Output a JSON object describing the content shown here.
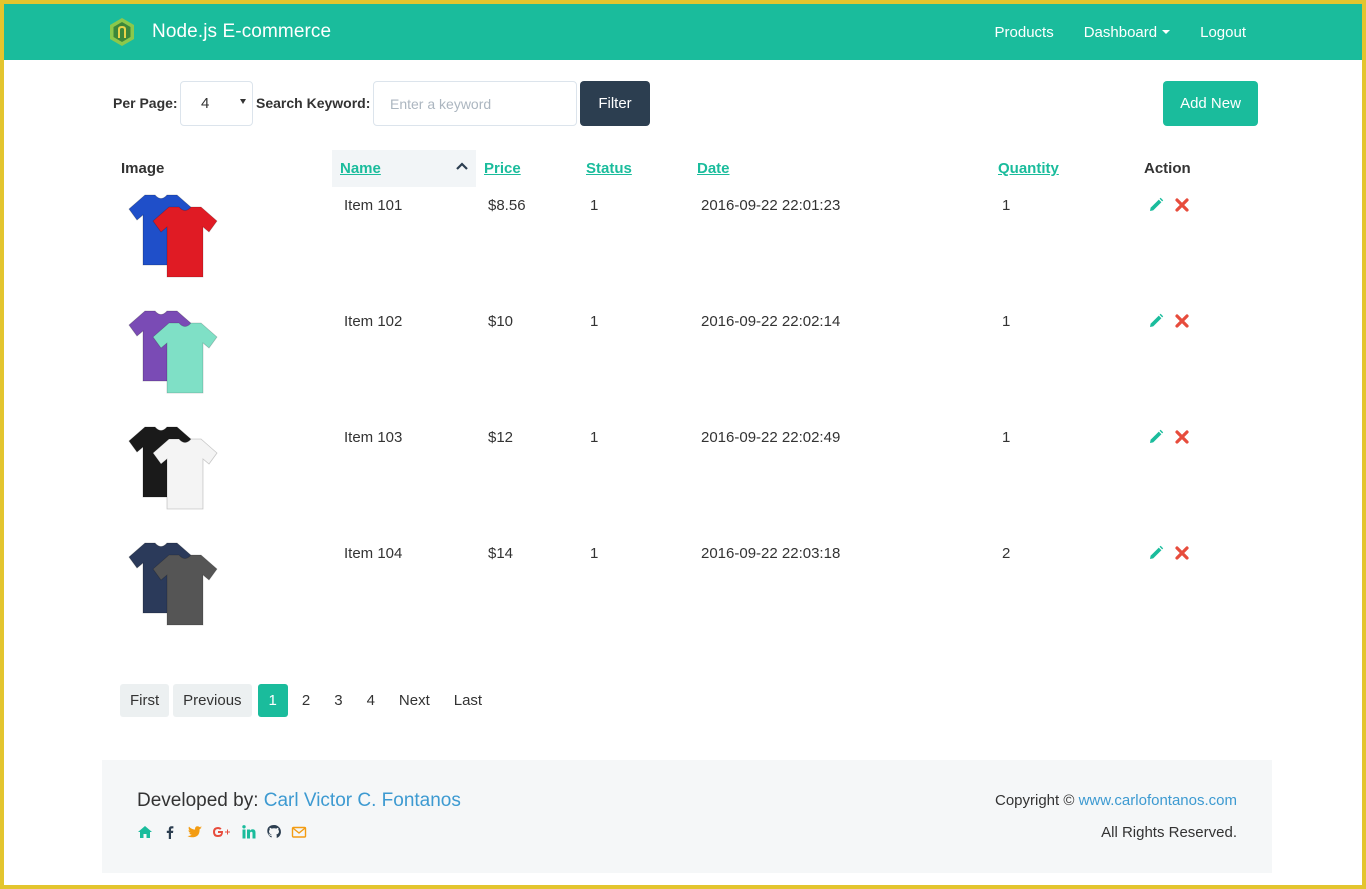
{
  "navbar": {
    "brand": "Node.js E-commerce",
    "links": [
      "Products",
      "Dashboard",
      "Logout"
    ]
  },
  "filters": {
    "per_page_label": "Per Page:",
    "per_page_value": "4",
    "search_label": "Search Keyword:",
    "search_placeholder": "Enter a keyword",
    "search_value": "",
    "filter_button": "Filter",
    "add_button": "Add New"
  },
  "table": {
    "headers": {
      "image": "Image",
      "name": "Name",
      "price": "Price",
      "status": "Status",
      "date": "Date",
      "quantity": "Quantity",
      "action": "Action"
    },
    "sorted_column": "Name",
    "rows": [
      {
        "name": "Item 101",
        "price": "$8.56",
        "status": "1",
        "date": "2016-09-22 22:01:23",
        "quantity": "1",
        "shirt_colors": [
          "#1f4fc9",
          "#e01b24"
        ]
      },
      {
        "name": "Item 102",
        "price": "$10",
        "status": "1",
        "date": "2016-09-22 22:02:14",
        "quantity": "1",
        "shirt_colors": [
          "#7a4bb5",
          "#7fe0c6"
        ]
      },
      {
        "name": "Item 103",
        "price": "$12",
        "status": "1",
        "date": "2016-09-22 22:02:49",
        "quantity": "1",
        "shirt_colors": [
          "#1a1a1a",
          "#f4f4f4"
        ]
      },
      {
        "name": "Item 104",
        "price": "$14",
        "status": "1",
        "date": "2016-09-22 22:03:18",
        "quantity": "2",
        "shirt_colors": [
          "#2b3a5a",
          "#555555"
        ]
      }
    ]
  },
  "pagination": {
    "first": "First",
    "previous": "Previous",
    "pages": [
      "1",
      "2",
      "3",
      "4"
    ],
    "active_page": "1",
    "next": "Next",
    "last": "Last"
  },
  "footer": {
    "developed_by": "Developed by:",
    "developer": "Carl Victor C. Fontanos",
    "copyright": "Copyright ©",
    "website": "www.carlofontanos.com",
    "rights": "All Rights Reserved.",
    "social_icons": [
      "home-icon",
      "facebook-icon",
      "twitter-icon",
      "google-plus-icon",
      "linkedin-icon",
      "github-icon",
      "envelope-icon"
    ]
  },
  "colors": {
    "primary": "#1abc9c",
    "dark": "#2c3e50",
    "link_blue": "#3d9ad1",
    "delete_red": "#e74c3c",
    "frame": "#e3c52e"
  }
}
